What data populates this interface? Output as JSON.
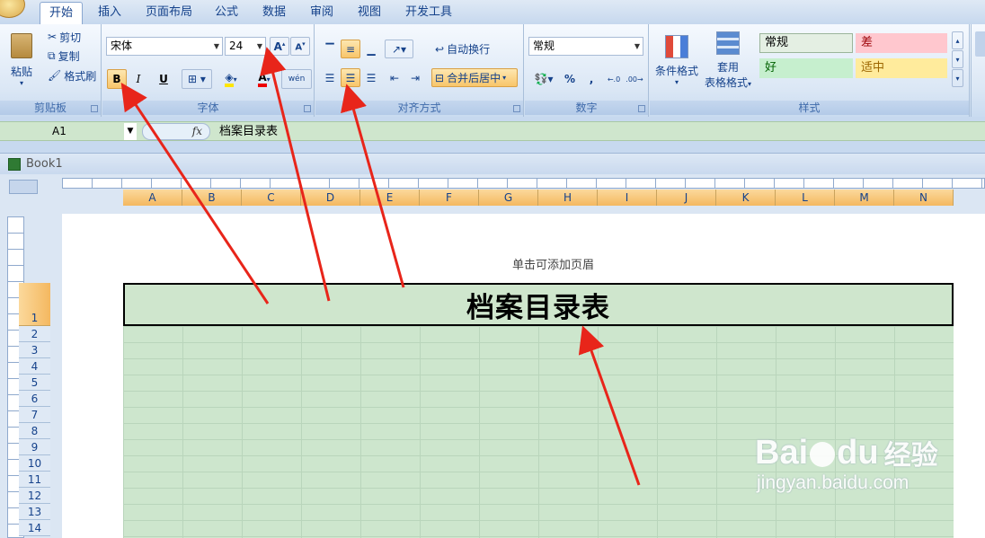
{
  "ribbon_tabs": [
    "开始",
    "插入",
    "页面布局",
    "公式",
    "数据",
    "审阅",
    "视图",
    "开发工具"
  ],
  "clipboard": {
    "paste": "粘贴",
    "cut": "剪切",
    "copy": "复制",
    "format_painter": "格式刷",
    "label": "剪贴板"
  },
  "font": {
    "name": "宋体",
    "size": "24",
    "bold": "B",
    "italic": "I",
    "underline": "U",
    "phonetic": "wén",
    "label": "字体"
  },
  "alignment": {
    "wrap": "自动换行",
    "merge": "合并后居中",
    "label": "对齐方式"
  },
  "number": {
    "format": "常规",
    "percent": "%",
    "comma": ",",
    "label": "数字"
  },
  "styles": {
    "conditional": "条件格式",
    "table_format_1": "套用",
    "table_format_2": "表格格式",
    "normal": "常规",
    "bad": "差",
    "good": "好",
    "neutral": "适中",
    "label": "样式"
  },
  "formula_bar": {
    "name_box": "A1",
    "fx": "fx",
    "content": "档案目录表"
  },
  "workbook": {
    "title": "Book1"
  },
  "columns": [
    "A",
    "B",
    "C",
    "D",
    "E",
    "F",
    "G",
    "H",
    "I",
    "J",
    "K",
    "L",
    "M",
    "N"
  ],
  "rows": [
    "1",
    "2",
    "3",
    "4",
    "5",
    "6",
    "7",
    "8",
    "9",
    "10",
    "11",
    "12",
    "13",
    "14"
  ],
  "page": {
    "header_hint": "单击可添加页眉",
    "a1_text": "档案目录表"
  },
  "watermark": {
    "brand": "Bai",
    "brand2": "du",
    "cn": "经验",
    "url": "jingyan.baidu.com"
  },
  "colors": {
    "accent": "#f4b860",
    "cell_fill": "#cde6cd",
    "arrow": "#e8251a"
  }
}
